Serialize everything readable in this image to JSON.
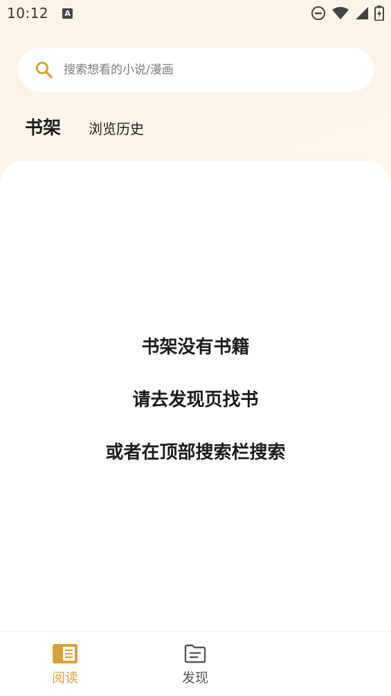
{
  "status_bar": {
    "time": "10:12",
    "notification_letter": "A",
    "icons": [
      "dnd-icon",
      "wifi-icon",
      "signal-icon",
      "battery-charging-icon"
    ]
  },
  "search": {
    "placeholder": "搜索想看的小说/漫画",
    "icon": "search-icon"
  },
  "tabs": [
    {
      "label": "书架",
      "active": true
    },
    {
      "label": "浏览历史",
      "active": false
    }
  ],
  "empty_state": {
    "line1": "书架没有书籍",
    "line2": "请去发现页找书",
    "line3": "或者在顶部搜索栏搜索"
  },
  "bottom_nav": {
    "items": [
      {
        "label": "阅读",
        "icon": "book-icon",
        "active": true
      },
      {
        "label": "发现",
        "icon": "folder-icon",
        "active": false
      }
    ]
  },
  "colors": {
    "accent": "#d8a23a",
    "text": "#1c1c1c",
    "background_tint": "#fbf3e6"
  }
}
